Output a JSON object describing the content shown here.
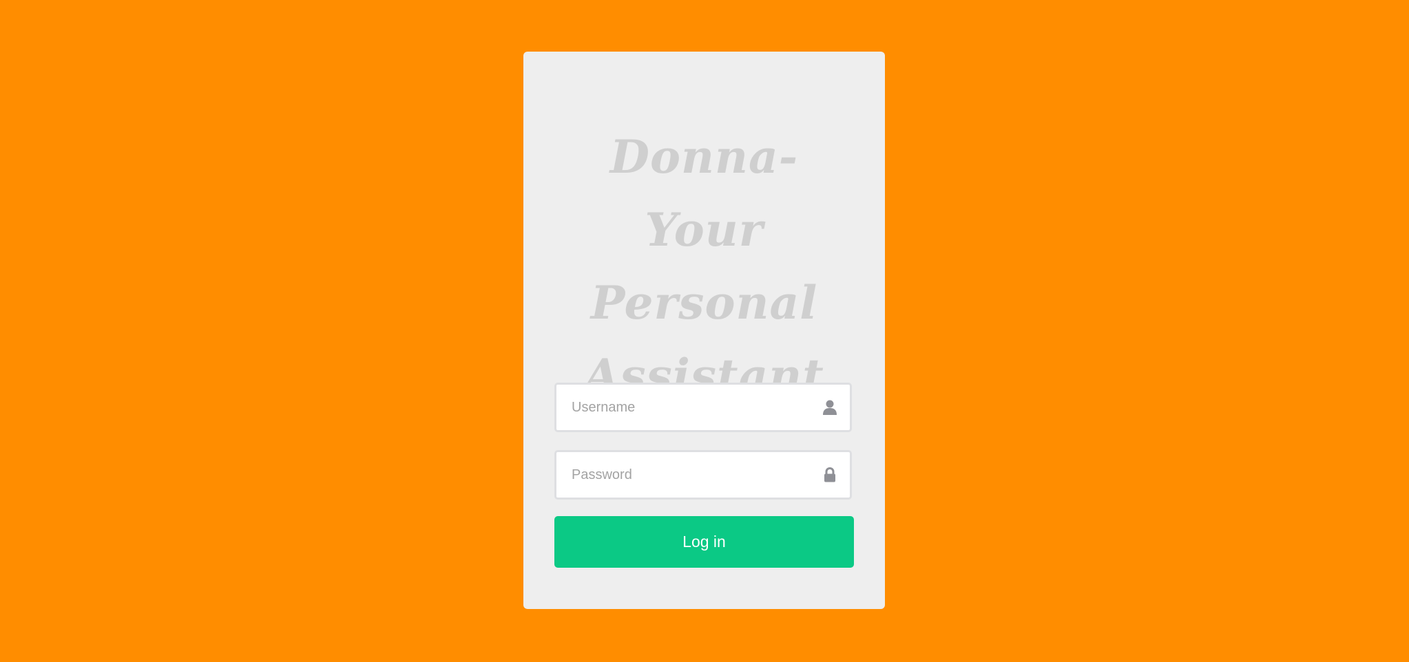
{
  "app": {
    "title": "Donna- Your Personal Assistant"
  },
  "login_form": {
    "username": {
      "value": "",
      "placeholder": "Username",
      "icon": "user-icon"
    },
    "password": {
      "value": "",
      "placeholder": "Password",
      "icon": "lock-icon"
    },
    "submit_label": "Log in"
  },
  "colors": {
    "background": "#ff8d00",
    "card": "#eeeeee",
    "title_text": "#cfcfcf",
    "field_border": "#dedfe2",
    "icon": "#8f9096",
    "button": "#0bc985",
    "button_text": "#ffffff"
  }
}
